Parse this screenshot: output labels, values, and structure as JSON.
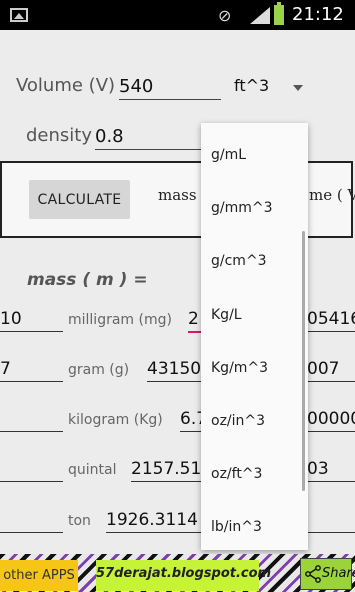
{
  "status_bar": {
    "time": "21:12"
  },
  "volume": {
    "label": "Volume (V)",
    "value": "540",
    "unit": "ft^3"
  },
  "density": {
    "label": "density",
    "value": "0.8"
  },
  "calculate_label": "CALCULATE",
  "formula_left": "mass ( m",
  "formula_right": "me ( V )",
  "mass_title": "mass ( m ) =",
  "rows": [
    {
      "label": "milligram (mg)",
      "left": "10",
      "center": "2",
      "right": "05416"
    },
    {
      "label": "gram (g)",
      "left": "7",
      "center": "43150",
      "right": "007"
    },
    {
      "label": "kilogram (Kg)",
      "left": "",
      "center": "6.7",
      "right": "00000"
    },
    {
      "label": "quintal",
      "left": "",
      "center": "2157.51",
      "right": "03"
    },
    {
      "label": "ton",
      "left": "",
      "center": "1926.3114",
      "right": ""
    }
  ],
  "density_units": [
    "g/mL",
    "g/mm^3",
    "g/cm^3",
    "Kg/L",
    "Kg/m^3",
    "oz/in^3",
    "oz/ft^3",
    "lb/in^3"
  ],
  "footer": {
    "other_apps": "other APPS",
    "blog": "57derajat.blogspot.com",
    "share": "Share"
  }
}
